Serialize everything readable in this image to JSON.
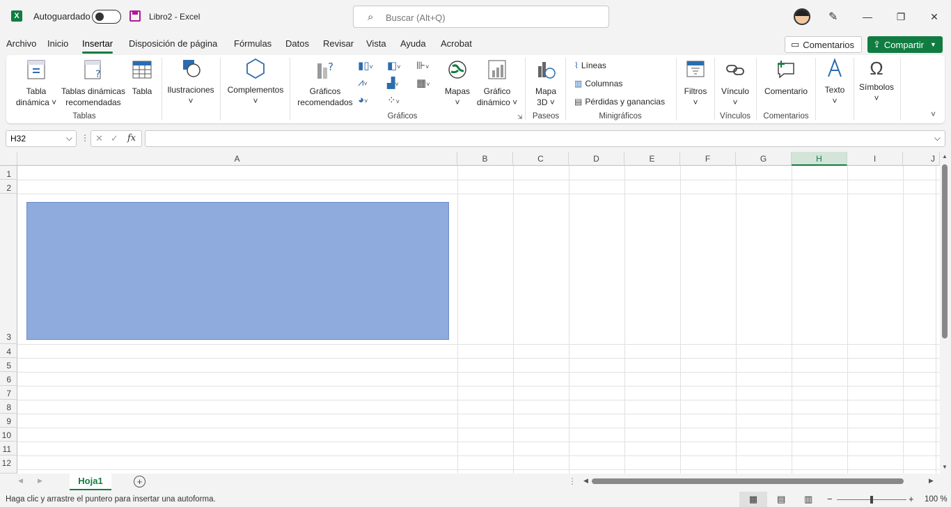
{
  "titlebar": {
    "app_logo": "X",
    "autosave_label": "Autoguardado",
    "doc_title": "Libro2  -  Excel",
    "search_placeholder": "Buscar (Alt+Q)",
    "minimize": "—",
    "restore": "❐",
    "close": "✕"
  },
  "tabs": [
    "Archivo",
    "Inicio",
    "Insertar",
    "Disposición de página",
    "Fórmulas",
    "Datos",
    "Revisar",
    "Vista",
    "Ayuda",
    "Acrobat"
  ],
  "active_tab": "Insertar",
  "actions": {
    "comments": "Comentarios",
    "share": "Compartir"
  },
  "ribbon": {
    "tabla_dinamica": [
      "Tabla",
      "dinámica ˅"
    ],
    "tablas_recomendadas": [
      "Tablas dinámicas",
      "recomendadas"
    ],
    "tabla": "Tabla",
    "group_tablas": "Tablas",
    "ilustraciones": "Ilustraciones",
    "complementos": "Complementos",
    "graficos_recomendados": [
      "Gráficos",
      "recomendados"
    ],
    "mapas": "Mapas",
    "grafico_dinamico": [
      "Gráfico",
      "dinámico ˅"
    ],
    "group_graficos": "Gráficos",
    "mapa3d": [
      "Mapa",
      "3D ˅"
    ],
    "group_paseos": "Paseos",
    "lineas": "Líneas",
    "columnas": "Columnas",
    "perdidas": "Pérdidas y ganancias",
    "group_minigraficos": "Minigráficos",
    "filtros": "Filtros",
    "vinculo": "Vínculo",
    "group_vinculos": "Vínculos",
    "comentario": "Comentario",
    "group_comentarios": "Comentarios",
    "texto": "Texto",
    "simbolos": "Símbolos"
  },
  "formula_bar": {
    "name_box": "H32",
    "fx": "fx",
    "formula": ""
  },
  "columns": [
    "A",
    "B",
    "C",
    "D",
    "E",
    "F",
    "G",
    "H",
    "I",
    "J"
  ],
  "selected_column": "H",
  "rows": [
    "1",
    "2",
    "3",
    "4",
    "5",
    "6",
    "7",
    "8",
    "9",
    "10",
    "11",
    "12"
  ],
  "sheet": {
    "tab": "Hoja1",
    "add": "+"
  },
  "status": {
    "message": "Haga clic y arrastre el puntero para insertar una autoforma.",
    "zoom": "100 %",
    "zoom_minus": "−",
    "zoom_plus": "+"
  },
  "colors": {
    "accent": "#107c41",
    "shape_fill": "#8faadc"
  }
}
